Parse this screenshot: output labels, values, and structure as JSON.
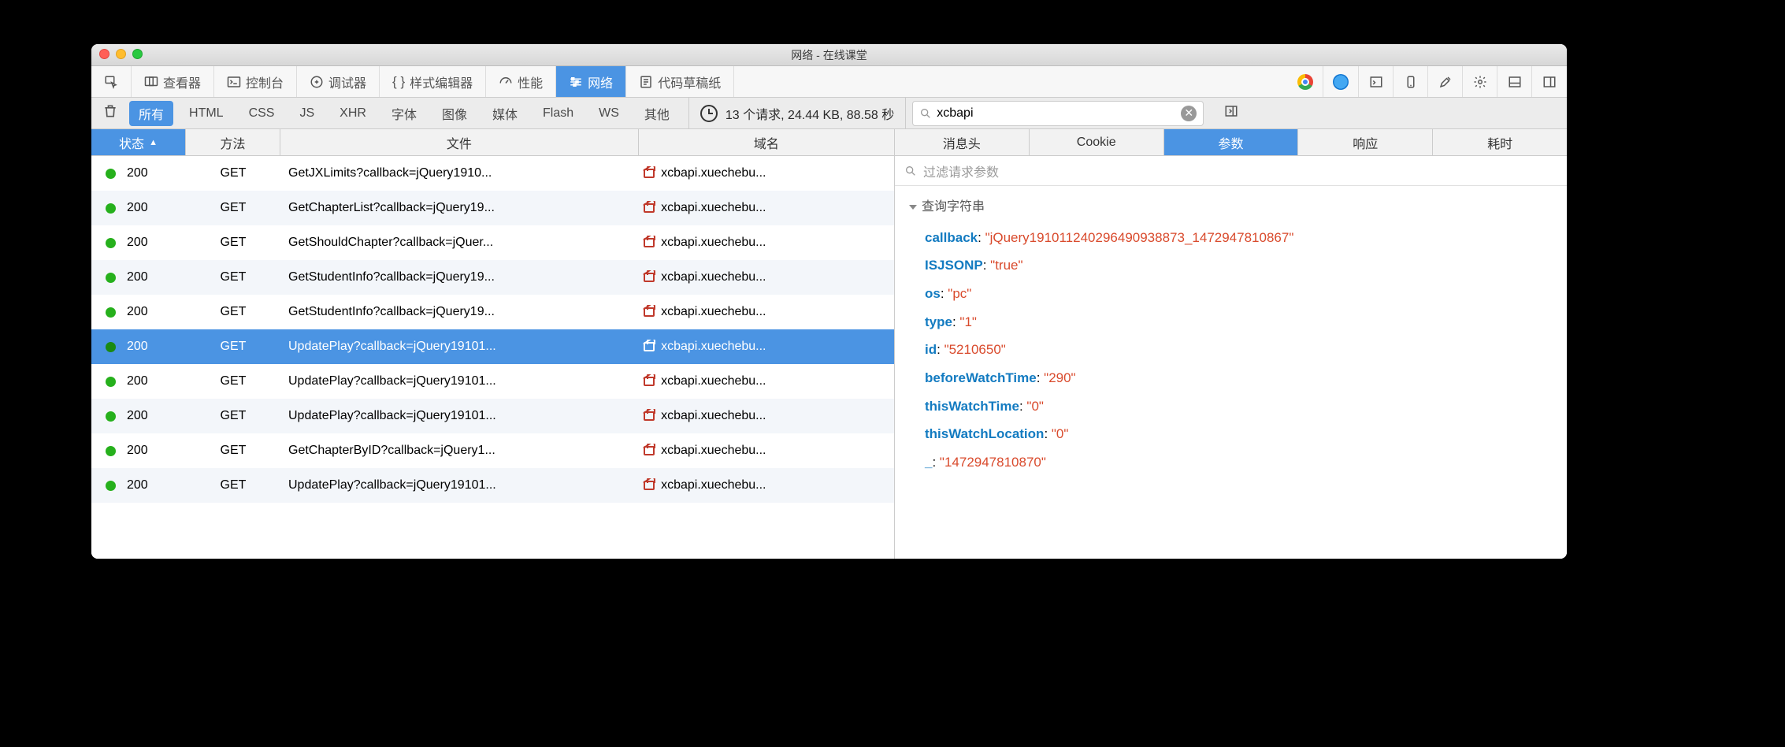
{
  "window": {
    "title": "网络 - 在线课堂"
  },
  "toolbar1": {
    "picker": "⇱",
    "inspector": "查看器",
    "console": "控制台",
    "debugger": "调试器",
    "style_editor": "样式编辑器",
    "performance": "性能",
    "network": "网络",
    "scratchpad": "代码草稿纸"
  },
  "filters": {
    "all": "所有",
    "html": "HTML",
    "css": "CSS",
    "js": "JS",
    "xhr": "XHR",
    "fonts": "字体",
    "images": "图像",
    "media": "媒体",
    "flash": "Flash",
    "ws": "WS",
    "other": "其他"
  },
  "stats": "13 个请求, 24.44 KB, 88.58 秒",
  "search": {
    "value": "xcbapi"
  },
  "left_headers": {
    "status": "状态",
    "method": "方法",
    "file": "文件",
    "domain": "域名"
  },
  "right_tabs": {
    "headers": "消息头",
    "cookie": "Cookie",
    "params": "参数",
    "response": "响应",
    "timings": "耗时"
  },
  "param_filter_placeholder": "过滤请求参数",
  "query_section_title": "查询字符串",
  "requests": [
    {
      "status": "200",
      "method": "GET",
      "file": "GetJXLimits?callback=jQuery1910...",
      "domain": "xcbapi.xuechebu...",
      "selected": false
    },
    {
      "status": "200",
      "method": "GET",
      "file": "GetChapterList?callback=jQuery19...",
      "domain": "xcbapi.xuechebu...",
      "selected": false
    },
    {
      "status": "200",
      "method": "GET",
      "file": "GetShouldChapter?callback=jQuer...",
      "domain": "xcbapi.xuechebu...",
      "selected": false
    },
    {
      "status": "200",
      "method": "GET",
      "file": "GetStudentInfo?callback=jQuery19...",
      "domain": "xcbapi.xuechebu...",
      "selected": false
    },
    {
      "status": "200",
      "method": "GET",
      "file": "GetStudentInfo?callback=jQuery19...",
      "domain": "xcbapi.xuechebu...",
      "selected": false
    },
    {
      "status": "200",
      "method": "GET",
      "file": "UpdatePlay?callback=jQuery19101...",
      "domain": "xcbapi.xuechebu...",
      "selected": true
    },
    {
      "status": "200",
      "method": "GET",
      "file": "UpdatePlay?callback=jQuery19101...",
      "domain": "xcbapi.xuechebu...",
      "selected": false
    },
    {
      "status": "200",
      "method": "GET",
      "file": "UpdatePlay?callback=jQuery19101...",
      "domain": "xcbapi.xuechebu...",
      "selected": false
    },
    {
      "status": "200",
      "method": "GET",
      "file": "GetChapterByID?callback=jQuery1...",
      "domain": "xcbapi.xuechebu...",
      "selected": false
    },
    {
      "status": "200",
      "method": "GET",
      "file": "UpdatePlay?callback=jQuery19101...",
      "domain": "xcbapi.xuechebu...",
      "selected": false
    }
  ],
  "params": [
    {
      "key": "callback",
      "value": "\"jQuery191011240296490938873_1472947810867\""
    },
    {
      "key": "ISJSONP",
      "value": "\"true\""
    },
    {
      "key": "os",
      "value": "\"pc\""
    },
    {
      "key": "type",
      "value": "\"1\""
    },
    {
      "key": "id",
      "value": "\"5210650\""
    },
    {
      "key": "beforeWatchTime",
      "value": "\"290\""
    },
    {
      "key": "thisWatchTime",
      "value": "\"0\""
    },
    {
      "key": "thisWatchLocation",
      "value": "\"0\""
    },
    {
      "key": "_",
      "value": "\"1472947810870\""
    }
  ]
}
